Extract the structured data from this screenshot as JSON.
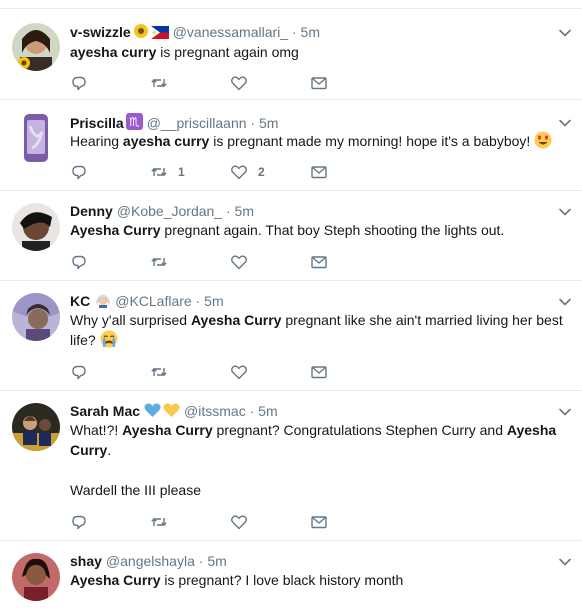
{
  "tweets": [
    {
      "name": "v-swizzle",
      "name_emojis": [
        "sunflower",
        "philippines-flag"
      ],
      "handle": "@vanessamallari_",
      "time": "5m",
      "segments": [
        [
          "b",
          "ayesha curry"
        ],
        [
          "t",
          " is pregnant again omg"
        ]
      ],
      "retweets": "",
      "likes": ""
    },
    {
      "name": "Priscilla",
      "name_emojis": [
        "scorpius"
      ],
      "handle": "@__priscillaann",
      "time": "5m",
      "segments": [
        [
          "t",
          "Hearing "
        ],
        [
          "b",
          "ayesha curry"
        ],
        [
          "t",
          " is pregnant made my morning! hope it's a babyboy! "
        ]
      ],
      "trailing_emoji": "heart-eyes",
      "retweets": "1",
      "likes": "2"
    },
    {
      "name": "Denny",
      "name_emojis": [],
      "handle": "@Kobe_Jordan_",
      "time": "5m",
      "segments": [
        [
          "b",
          "Ayesha Curry"
        ],
        [
          "t",
          " pregnant again. That boy Steph shooting the lights out."
        ]
      ],
      "retweets": "",
      "likes": ""
    },
    {
      "name": "KC",
      "name_emojis": [
        "woman-white-hair"
      ],
      "handle": "@KCLaflare",
      "time": "5m",
      "segments": [
        [
          "t",
          "Why y'all surprised "
        ],
        [
          "b",
          "Ayesha Curry"
        ],
        [
          "t",
          " pregnant like she ain't married living her best life? "
        ]
      ],
      "trailing_emoji": "crying",
      "retweets": "",
      "likes": ""
    },
    {
      "name": "Sarah Mac",
      "name_emojis": [
        "blue-heart",
        "yellow-heart"
      ],
      "handle": "@itssmac",
      "time": "5m",
      "segments": [
        [
          "t",
          "What!?! "
        ],
        [
          "b",
          "Ayesha Curry"
        ],
        [
          "t",
          " pregnant? Congratulations Stephen Curry and "
        ],
        [
          "b",
          "Ayesha Curry"
        ],
        [
          "t",
          "."
        ],
        [
          "br",
          ""
        ],
        [
          "br",
          ""
        ],
        [
          "t",
          "Wardell the III please"
        ]
      ],
      "retweets": "",
      "likes": ""
    },
    {
      "name": "shay",
      "name_emojis": [],
      "handle": "@angelshayla",
      "time": "5m",
      "segments": [
        [
          "b",
          "Ayesha Curry"
        ],
        [
          "t",
          " is pregnant? I love black history month"
        ]
      ],
      "retweets": "",
      "likes": ""
    }
  ],
  "separator": "·",
  "colors": {
    "text": "#14171a",
    "secondary": "#657786",
    "border": "#e6ecf0",
    "background": "#ffffff"
  },
  "icons": [
    "reply-icon",
    "retweet-icon",
    "like-icon",
    "message-icon",
    "caret-down-icon"
  ]
}
